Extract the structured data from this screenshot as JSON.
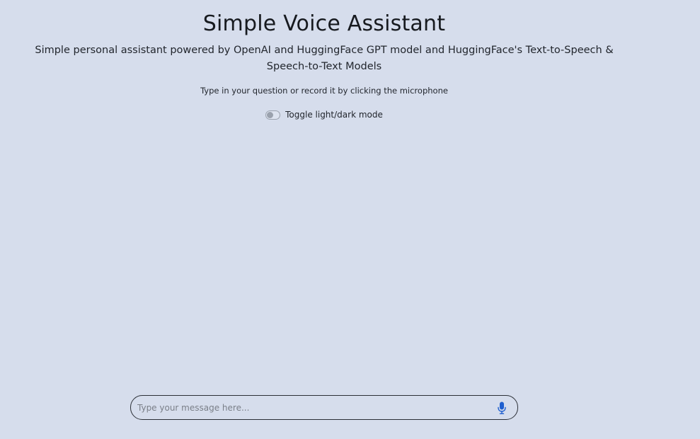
{
  "header": {
    "title": "Simple Voice Assistant",
    "subtitle": "Simple personal assistant powered by OpenAI and HuggingFace GPT model and HuggingFace's Text-to-Speech & Speech-to-Text Models",
    "instructions": "Type in your question or record it by clicking the microphone"
  },
  "theme_toggle": {
    "label": "Toggle light/dark mode",
    "checked": false
  },
  "composer": {
    "placeholder": "Type your message here...",
    "value": "",
    "mic_icon": "microphone-icon"
  },
  "colors": {
    "background": "#d6ddec",
    "mic_accent": "#1f5fcf",
    "text": "#1b1e24"
  }
}
